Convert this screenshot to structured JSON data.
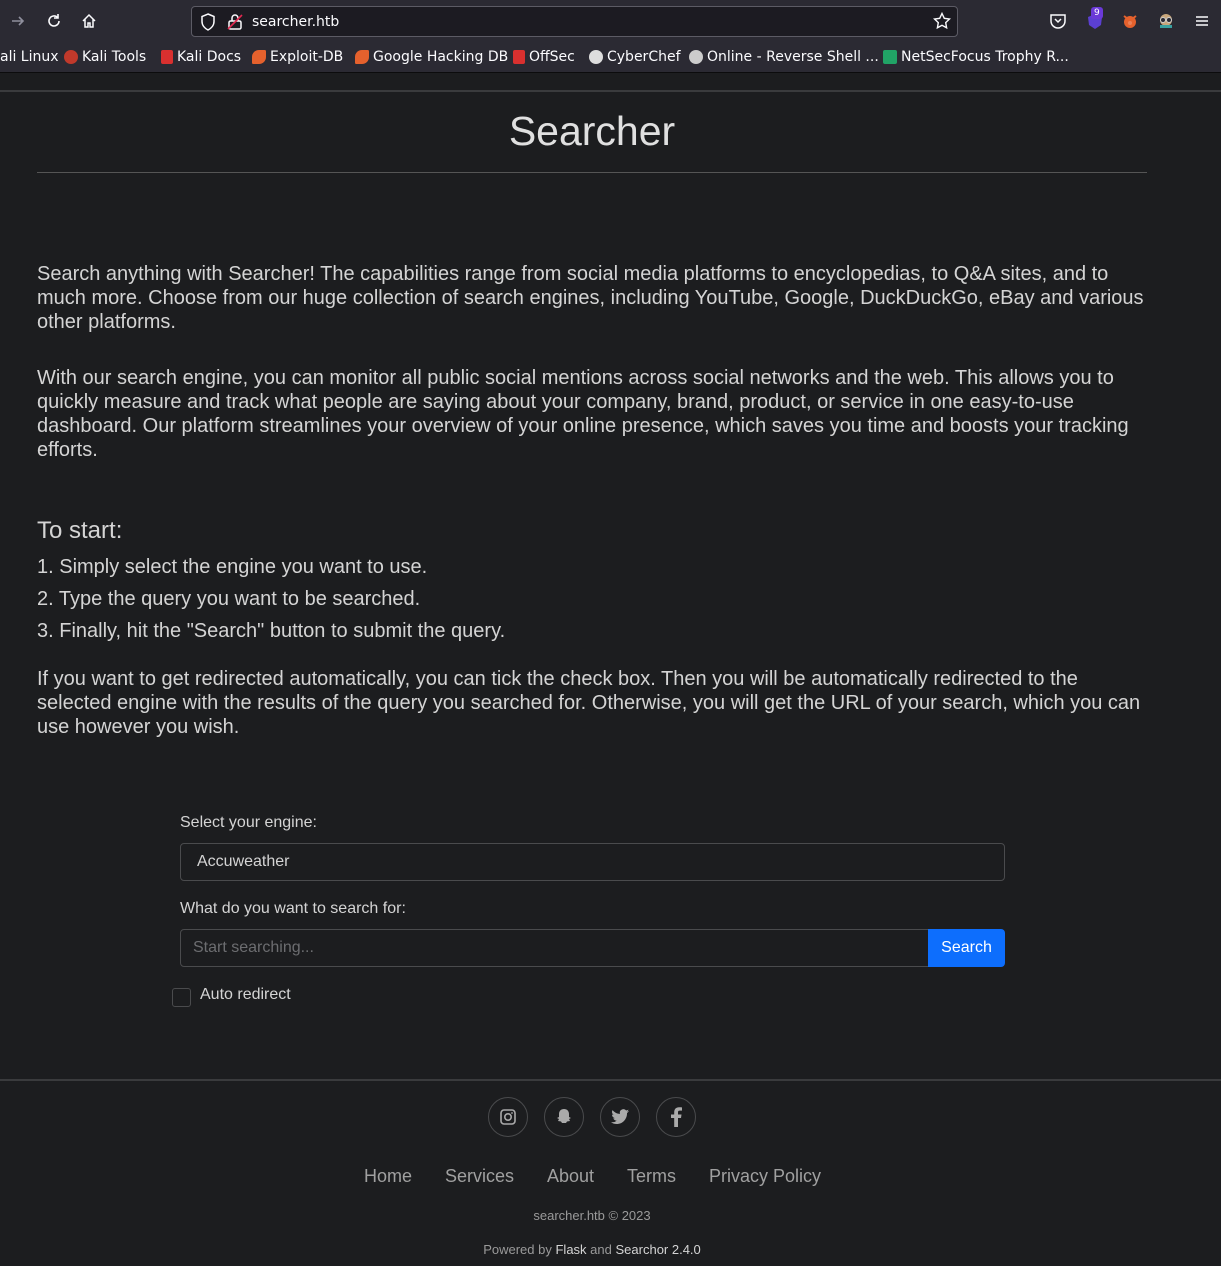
{
  "browser": {
    "url": "searcher.htb",
    "extension_badge": "9",
    "bookmarks": [
      {
        "label": "ali Linux",
        "icon": "kali-icon",
        "color": "#2b2a33"
      },
      {
        "label": "Kali Tools",
        "icon": "kali-tools-icon",
        "color": "#c0392b"
      },
      {
        "label": "Kali Docs",
        "icon": "kali-docs-icon",
        "color": "#d9302f"
      },
      {
        "label": "Exploit-DB",
        "icon": "exploit-db-icon",
        "color": "#e5612d"
      },
      {
        "label": "Google Hacking DB",
        "icon": "ghdb-icon",
        "color": "#e5612d"
      },
      {
        "label": "OffSec",
        "icon": "offsec-icon",
        "color": "#d9302f"
      },
      {
        "label": "CyberChef",
        "icon": "cyberchef-icon",
        "color": "#dddddd"
      },
      {
        "label": "Online - Reverse Shell ...",
        "icon": "skull-icon",
        "color": "#cccccc"
      },
      {
        "label": "NetSecFocus Trophy R...",
        "icon": "netsecfocus-icon",
        "color": "#21a366"
      }
    ]
  },
  "page": {
    "title": "Searcher",
    "intro_1": "Search anything with Searcher! The capabilities range from social media platforms to encyclopedias, to Q&A sites, and to much more. Choose from our huge collection of search engines, including YouTube, Google, DuckDuckGo, eBay and various other platforms.",
    "intro_2": "With our search engine, you can monitor all public social mentions across social networks and the web. This allows you to quickly measure and track what people are saying about your company, brand, product, or service in one easy-to-use dashboard. Our platform streamlines your overview of your online presence, which saves you time and boosts your tracking efforts.",
    "to_start": "To start:",
    "steps": [
      "1. Simply select the engine you want to use.",
      "2. Type the query you want to be searched.",
      "3. Finally, hit the \"Search\" button to submit the query."
    ],
    "redirect_info": "If you want to get redirected automatically, you can tick the check box. Then you will be automatically redirected to the selected engine with the results of the query you searched for. Otherwise, you will get the URL of your search, which you can use however you wish."
  },
  "form": {
    "engine_label": "Select your engine:",
    "engine_value": "Accuweather",
    "query_label": "What do you want to search for:",
    "query_placeholder": "Start searching...",
    "search_button": "Search",
    "auto_redirect_label": "Auto redirect"
  },
  "footer": {
    "social_icons": [
      "instagram-icon",
      "snapchat-icon",
      "twitter-icon",
      "facebook-icon"
    ],
    "links": [
      "Home",
      "Services",
      "About",
      "Terms",
      "Privacy Policy"
    ],
    "copyright": "searcher.htb © 2023",
    "powered_prefix": "Powered by",
    "powered_flask": "Flask",
    "powered_and": "and",
    "powered_searchor": "Searchor 2.4.0"
  }
}
